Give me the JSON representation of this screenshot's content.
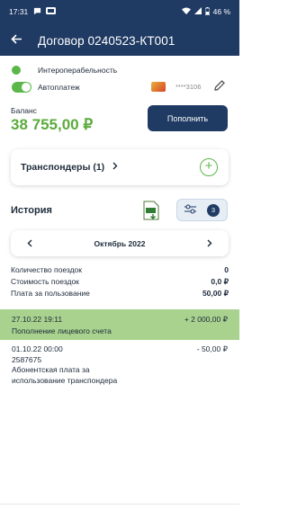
{
  "status": {
    "time": "17:31",
    "battery": "46 %"
  },
  "appbar": {
    "title": "Договор 0240523-КТ001"
  },
  "options": [
    {
      "label": "Интероперабельность"
    },
    {
      "label": "Автоплатеж"
    }
  ],
  "card": {
    "masked": "****3106"
  },
  "balance": {
    "label": "Баланс",
    "value": "38 755,00 ₽",
    "topup_label": "Пополнить"
  },
  "transponders": {
    "label": "Транспондеры (1)"
  },
  "history": {
    "title": "История",
    "filter_count": "3"
  },
  "month": {
    "label": "Октябрь 2022"
  },
  "stats": [
    {
      "label": "Количество поездок",
      "value": "0"
    },
    {
      "label": "Стоимость поездок",
      "value": "0,0 ₽"
    },
    {
      "label": "Плата за пользование",
      "value": "50,00 ₽"
    }
  ],
  "transactions": [
    {
      "date": "27.10.22 19:11",
      "amount": "+ 2 000,00 ₽",
      "description": "Пополнение лицевого счета"
    },
    {
      "date": "01.10.22 00:00",
      "amount": "- 50,00 ₽",
      "id": "2587675",
      "description_1": "Абонентская плата за",
      "description_2": "использование транспондера"
    }
  ],
  "colors": {
    "primary": "#1f3a63",
    "green": "#5bb749",
    "highlight": "#a8d28e"
  }
}
